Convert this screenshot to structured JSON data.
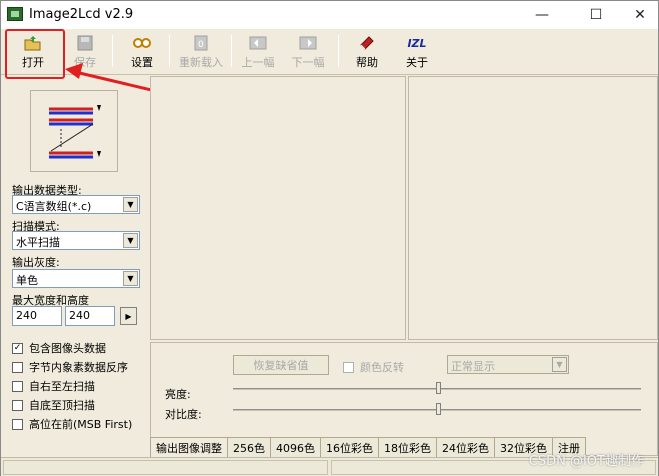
{
  "window": {
    "title": "Image2Lcd v2.9",
    "controls": {
      "minimize": "—",
      "maximize": "☐",
      "close": "✕"
    }
  },
  "toolbar": {
    "open": "打开",
    "save": "保存",
    "settings": "设置",
    "reload": "重新载入",
    "prev": "上一幅",
    "next": "下一幅",
    "help": "帮助",
    "about": "关于",
    "about_icon_text": "IZL"
  },
  "left": {
    "output_type_label": "输出数据类型:",
    "output_type_value": "C语言数组(*.c)",
    "scan_mode_label": "扫描模式:",
    "scan_mode_value": "水平扫描",
    "gray_label": "输出灰度:",
    "gray_value": "单色",
    "maxsize_label": "最大宽度和高度",
    "width": "240",
    "height": "240",
    "spin": "▶",
    "options": [
      {
        "label": "包含图像头数据",
        "checked": true
      },
      {
        "label": "字节内象素数据反序",
        "checked": false
      },
      {
        "label": "自右至左扫描",
        "checked": false
      },
      {
        "label": "自底至顶扫描",
        "checked": false
      },
      {
        "label": "高位在前(MSB First)",
        "checked": false
      }
    ]
  },
  "adjust": {
    "restore_button": "恢复缺省值",
    "invert_label": "颜色反转",
    "display_mode": "正常显示",
    "brightness_label": "亮度:",
    "contrast_label": "对比度:",
    "brightness_level": 0.5,
    "contrast_level": 0.5
  },
  "tabs": [
    "输出图像调整",
    "256色",
    "4096色",
    "16位彩色",
    "18位彩色",
    "24位彩色",
    "32位彩色",
    "注册"
  ],
  "watermark": "CSDN @IOT趣制作",
  "colors": {
    "highlight": "#e02020"
  }
}
